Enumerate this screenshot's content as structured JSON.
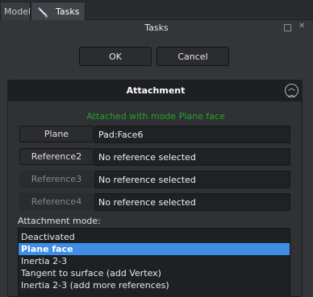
{
  "tabs": [
    {
      "label": "Model"
    },
    {
      "label": "Tasks"
    }
  ],
  "panel": {
    "title": "Tasks"
  },
  "dialog_buttons": {
    "ok": "OK",
    "cancel": "Cancel"
  },
  "attachment": {
    "title": "Attachment",
    "status": "Attached with mode Plane face",
    "references": [
      {
        "button": "Plane",
        "value": "Pad:Face6",
        "enabled": true
      },
      {
        "button": "Reference2",
        "value": "No reference selected",
        "enabled": true
      },
      {
        "button": "Reference3",
        "value": "No reference selected",
        "enabled": false
      },
      {
        "button": "Reference4",
        "value": "No reference selected",
        "enabled": false
      }
    ],
    "mode_label": "Attachment mode:",
    "modes": [
      "Deactivated",
      "Plane face",
      "Inertia 2-3",
      "Tangent to surface (add Vertex)",
      "Inertia 2-3 (add more references)"
    ],
    "selected_mode": "Plane face"
  },
  "colors": {
    "status_ok": "#26a326",
    "selection": "#3d8ee4"
  },
  "icons": {
    "tasks_tab": "pencil-icon",
    "collapse": "chevron-up-icon"
  }
}
